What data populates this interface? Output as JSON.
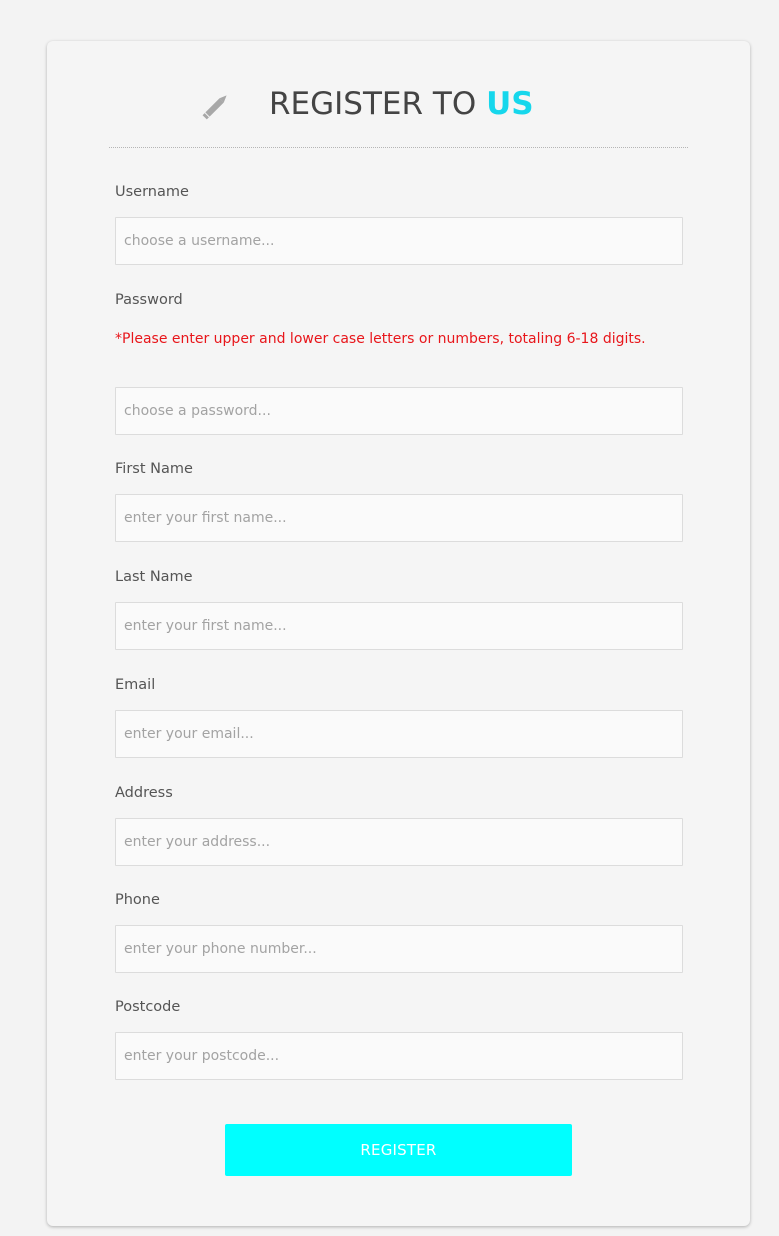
{
  "header": {
    "title_main": "REGISTER TO ",
    "title_accent": "US",
    "icon": "pencil-icon",
    "accent_color": "#16d7ec"
  },
  "form": {
    "username": {
      "label": "Username",
      "placeholder": "choose a username..."
    },
    "password": {
      "label": "Password",
      "hint": "*Please enter upper and lower case letters or numbers, totaling 6-18 digits.",
      "placeholder": "choose a password..."
    },
    "first_name": {
      "label": "First Name",
      "placeholder": "enter your first name..."
    },
    "last_name": {
      "label": "Last Name",
      "placeholder": "enter your first name..."
    },
    "email": {
      "label": "Email",
      "placeholder": "enter your email..."
    },
    "address": {
      "label": "Address",
      "placeholder": "enter your address..."
    },
    "phone": {
      "label": "Phone",
      "placeholder": "enter your phone number..."
    },
    "postcode": {
      "label": "Postcode",
      "placeholder": "enter your postcode..."
    }
  },
  "actions": {
    "register_label": "REGISTER",
    "button_color": "#00ffff"
  },
  "colors": {
    "hint": "#e8161b"
  }
}
